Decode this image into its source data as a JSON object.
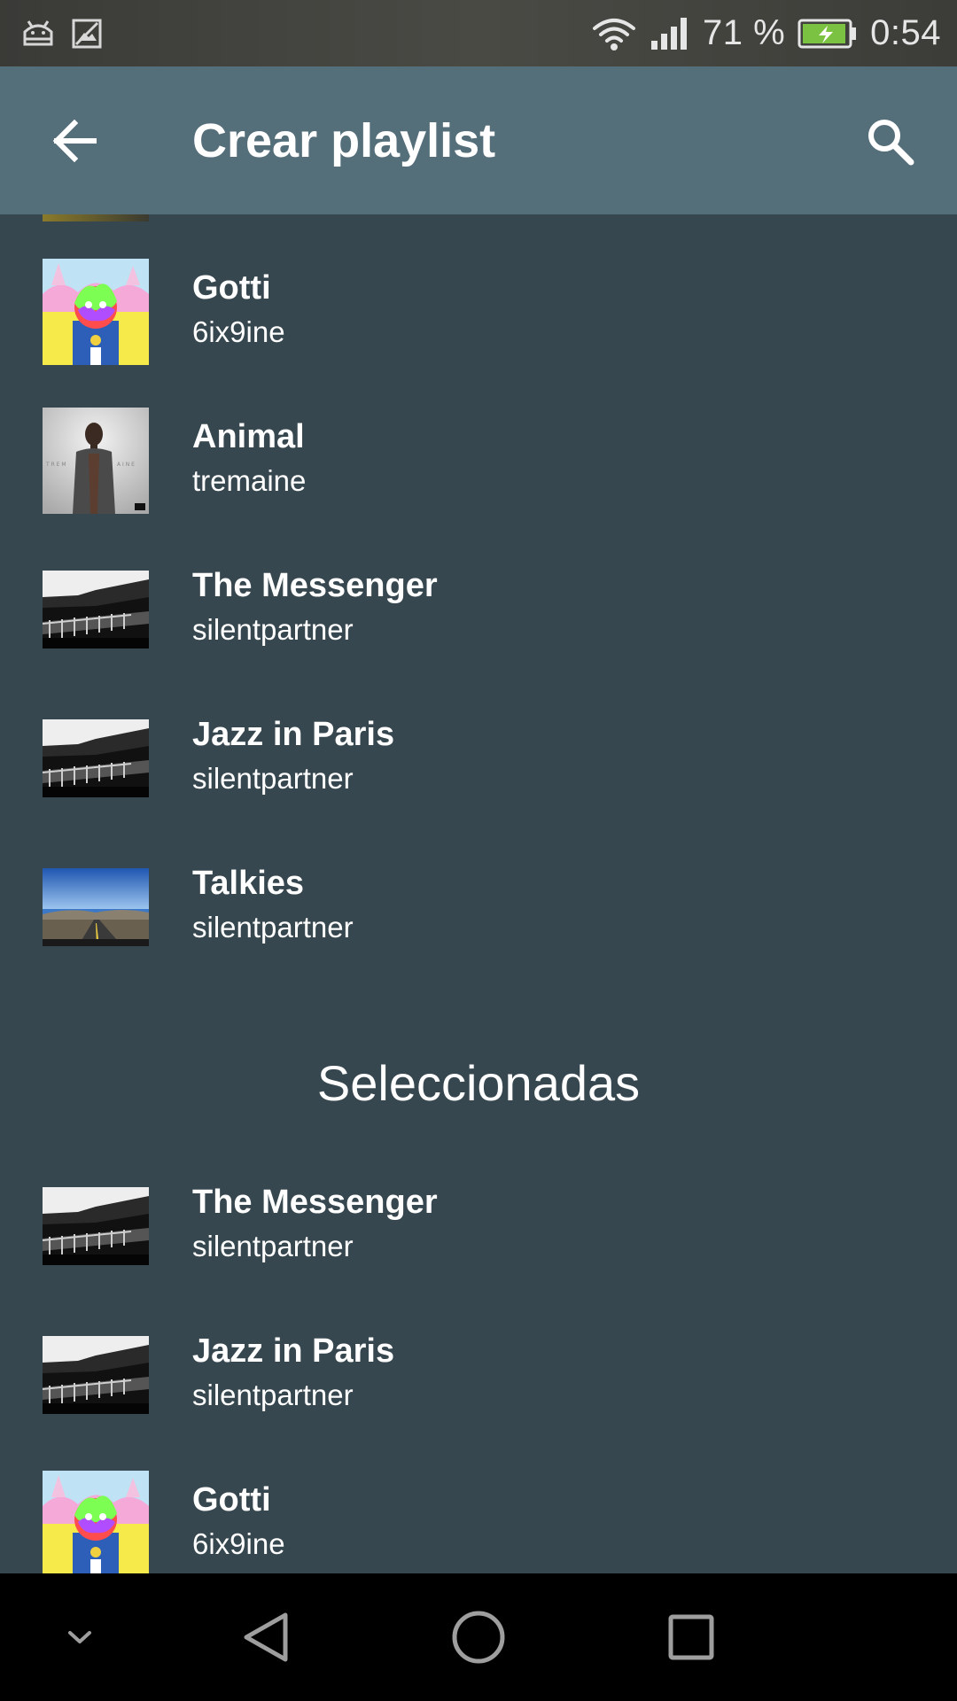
{
  "status_bar": {
    "battery_percent": "71 %",
    "time": "0:54",
    "icons": [
      "android-debug-icon",
      "image-notification-icon",
      "wifi-icon",
      "cell-signal-icon",
      "battery-charging-icon"
    ]
  },
  "toolbar": {
    "title": "Crear playlist",
    "back_icon": "arrow-back-icon",
    "search_icon": "search-icon",
    "background_color": "#546e7a"
  },
  "songs": [
    {
      "title": "Gotti",
      "artist": "6ix9ine",
      "art": "gotti-cover"
    },
    {
      "title": "Animal",
      "artist": "tremaine",
      "art": "tremaine-cover"
    },
    {
      "title": "The Messenger",
      "artist": "silentpartner",
      "art": "coast-bw-cover"
    },
    {
      "title": "Jazz in Paris",
      "artist": "silentpartner",
      "art": "coast-bw-cover"
    },
    {
      "title": "Talkies",
      "artist": "silentpartner",
      "art": "road-cover"
    }
  ],
  "selected_heading": "Seleccionadas",
  "selected": [
    {
      "title": "The Messenger",
      "artist": "silentpartner",
      "art": "coast-bw-cover"
    },
    {
      "title": "Jazz in Paris",
      "artist": "silentpartner",
      "art": "coast-bw-cover"
    },
    {
      "title": "Gotti",
      "artist": "6ix9ine",
      "art": "gotti-cover"
    }
  ],
  "nav_bar": {
    "icons": [
      "chevron-down-icon",
      "nav-back-icon",
      "nav-home-icon",
      "nav-recents-icon"
    ]
  },
  "colors": {
    "background": "#37474f",
    "toolbar": "#546e7a",
    "text": "#ffffff",
    "nav_bar": "#000000"
  }
}
